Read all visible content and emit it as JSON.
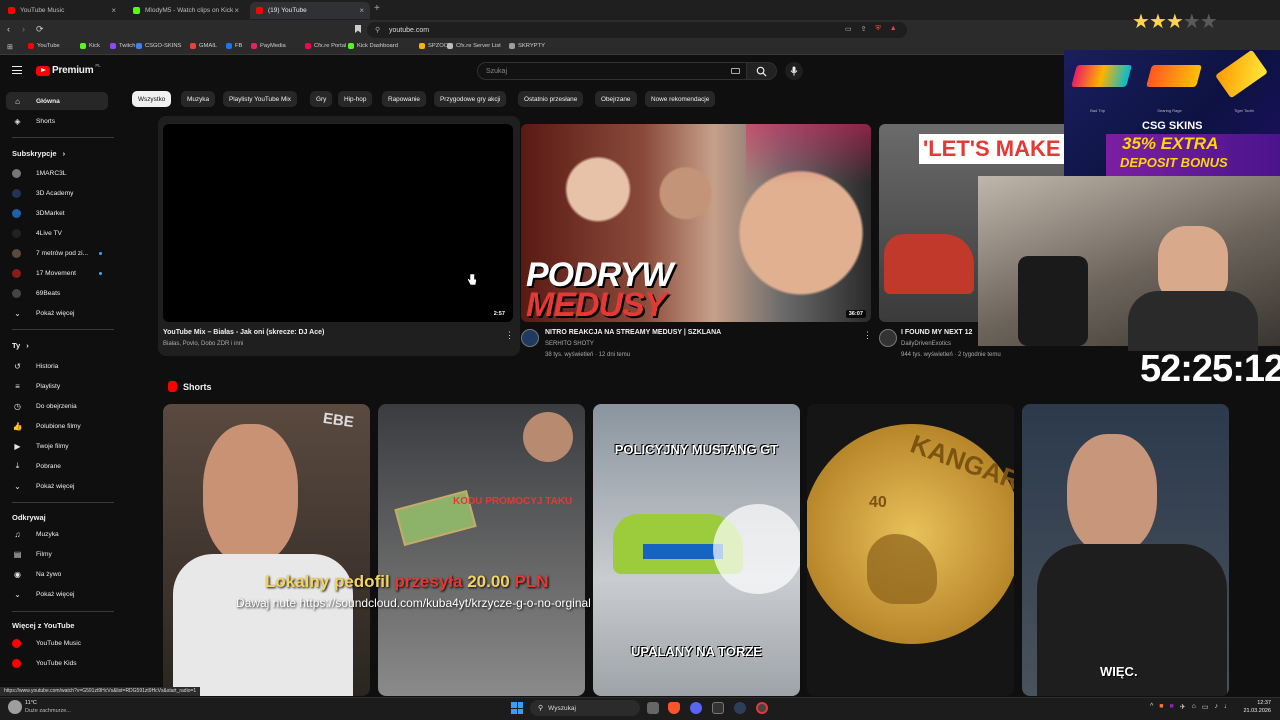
{
  "browser": {
    "tabs": [
      {
        "title": "YouTube Music",
        "color": "#ff0000"
      },
      {
        "title": "MlodyM5 - Watch clips on Kick",
        "color": "#53fc18"
      },
      {
        "title": "(19) YouTube",
        "color": "#ff0000"
      }
    ],
    "new_tab": "+",
    "url": "youtube.com",
    "bookmarks": [
      {
        "label": "YouTube",
        "color": "#ff0000"
      },
      {
        "label": "Kick",
        "color": "#53fc18"
      },
      {
        "label": "Twitch",
        "color": "#9146ff"
      },
      {
        "label": "CSGO-SKINS",
        "color": "#3b82f6"
      },
      {
        "label": "GMAIL",
        "color": "#ea4335"
      },
      {
        "label": "FB",
        "color": "#1877f2"
      },
      {
        "label": "PayMedia",
        "color": "#e0245e"
      },
      {
        "label": "Cfx.re Portal",
        "color": "#f40552"
      },
      {
        "label": "Kick Dashboard",
        "color": "#53fc18"
      },
      {
        "label": "SPZOO",
        "color": "#ffb300"
      },
      {
        "label": "Cfx.re Server List",
        "color": "#bbbbbb"
      },
      {
        "label": "SKRYPTY",
        "color": "#9e9e9e"
      }
    ]
  },
  "masthead": {
    "logo_text": "Premium",
    "logo_sup": "PL",
    "search_placeholder": "Szukaj"
  },
  "sidebar": {
    "main": [
      {
        "label": "Główna",
        "icon": "home-icon"
      },
      {
        "label": "Shorts",
        "icon": "shorts-icon"
      }
    ],
    "subscriptions_title": "Subskrypcje",
    "subscriptions": [
      {
        "label": "1MARC3L",
        "color": "#777777",
        "new": false
      },
      {
        "label": "3D Academy",
        "color": "#223355",
        "new": false
      },
      {
        "label": "3DMarket",
        "color": "#1d5fa8",
        "new": false
      },
      {
        "label": "4Live TV",
        "color": "#222222",
        "new": false
      },
      {
        "label": "7 metrów pod zi...",
        "color": "#5b4a3a",
        "new": true
      },
      {
        "label": "17 Movement",
        "color": "#8b1a1a",
        "new": true
      },
      {
        "label": "69Beats",
        "color": "#444444",
        "new": false
      }
    ],
    "show_more": "Pokaż więcej",
    "you_title": "Ty",
    "you": [
      {
        "label": "Historia",
        "icon": "history-icon"
      },
      {
        "label": "Playlisty",
        "icon": "playlist-icon"
      },
      {
        "label": "Do obejrzenia",
        "icon": "clock-icon"
      },
      {
        "label": "Polubione filmy",
        "icon": "like-icon"
      },
      {
        "label": "Twoje filmy",
        "icon": "video-icon"
      },
      {
        "label": "Pobrane",
        "icon": "download-icon"
      }
    ],
    "explore_title": "Odkrywaj",
    "explore": [
      {
        "label": "Muzyka",
        "icon": "music-icon"
      },
      {
        "label": "Filmy",
        "icon": "film-icon"
      },
      {
        "label": "Na żywo",
        "icon": "live-icon"
      }
    ],
    "more_title": "Więcej z YouTube",
    "more": [
      {
        "label": "YouTube Music",
        "color": "#ff0000"
      },
      {
        "label": "YouTube Kids",
        "color": "#ff0000"
      }
    ]
  },
  "chips": [
    "Wszystko",
    "Muzyka",
    "Playlisty YouTube Mix",
    "Gry",
    "Hip-hop",
    "Rapowanie",
    "Przygodowe gry akcji",
    "Ostatnio przesłane",
    "Obejrzane",
    "Nowe rekomendacje"
  ],
  "videos": [
    {
      "title": "YouTube Mix – Białas - Jak oni (skrecze: DJ Ace)",
      "channel": "Białas, Povlo, Dobo ZDR i inni",
      "meta": "",
      "duration": "2:57"
    },
    {
      "title": "NITRO REAKCJA NA STREAMY MEDUSY | SZKLANA",
      "channel": "SERHITO SHOTY",
      "meta": "38 tys. wyświetleń · 12 dni temu",
      "duration": "36:07",
      "thumb_text_1": "PODRYW",
      "thumb_text_2": "MEDUSY"
    },
    {
      "title": "I FOUND MY NEXT 12",
      "channel": "DailyDrivenExotics",
      "meta": "944 tys. wyświetleń · 2 tygodnie temu",
      "duration": "",
      "thumb_text": "'LET'S MAKE A DE"
    }
  ],
  "shorts_title": "Shorts",
  "shorts": [
    {
      "caption": "",
      "bg": "#6b5a50"
    },
    {
      "caption": "KODU PROMOCYJ TAKU",
      "bg": "#3d3f45"
    },
    {
      "caption_top": "POLICYJNY MUSTANG GT",
      "caption_bottom": "UPALANY NA TORZE",
      "bg": "#9aa3ad"
    },
    {
      "caption": "KANGAROO",
      "value": "40",
      "bg": "#1a1a1a"
    },
    {
      "caption": "WIĘC.",
      "bg": "#3c4652"
    }
  ],
  "overlay": {
    "alert_line_1_a": "Lokalny pedofil",
    "alert_line_1_b": "przesyła",
    "alert_line_1_c": "20.00",
    "alert_line_1_d": "PLN",
    "alert_line_2": "Dawaj nute https://soundcloud.com/kuba4yt/krzycze-g-o-no-orginal",
    "timer": "52:25:12",
    "stars_filled": 3,
    "stars_total": 5,
    "sponsor": "CSG SKINS",
    "sponsor_promo_1": "35% EXTRA",
    "sponsor_promo_2": "DEPOSIT BONUS",
    "sponsor_items": [
      "Bad Trip",
      "Searing Rage",
      "Tiger Tooth"
    ]
  },
  "status_url": "https://www.youtube.com/watch?v=G591zt9HcVs&list=RDG591zt9HcVs&start_radio=1",
  "taskbar": {
    "weather_temp": "11°C",
    "weather_text": "Duże zachmurze...",
    "search": "Wyszukaj",
    "time": "12:37",
    "date": "21.03.2026"
  }
}
